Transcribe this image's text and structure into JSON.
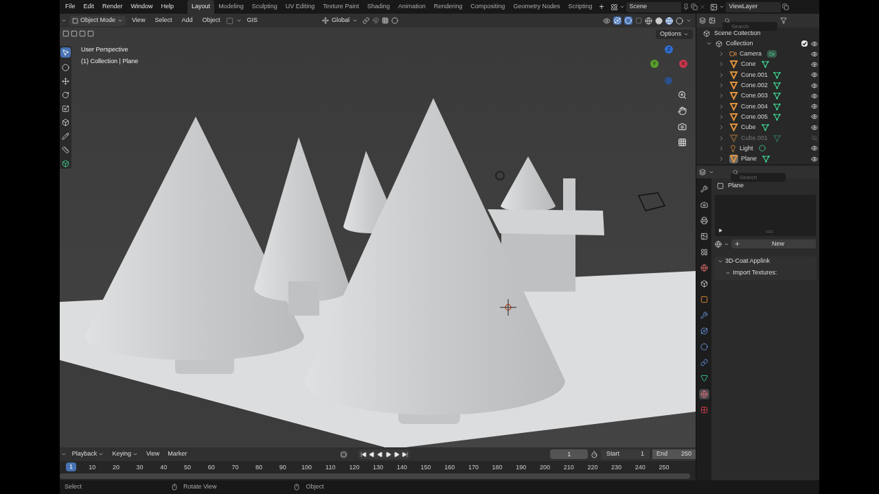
{
  "menu": [
    "File",
    "Edit",
    "Render",
    "Window",
    "Help"
  ],
  "workspaces": [
    {
      "label": "Layout",
      "selected": true
    },
    {
      "label": "Modeling",
      "selected": false
    },
    {
      "label": "Sculpting",
      "selected": false
    },
    {
      "label": "UV Editing",
      "selected": false
    },
    {
      "label": "Texture Paint",
      "selected": false
    },
    {
      "label": "Shading",
      "selected": false
    },
    {
      "label": "Animation",
      "selected": false
    },
    {
      "label": "Rendering",
      "selected": false
    },
    {
      "label": "Compositing",
      "selected": false
    },
    {
      "label": "Geometry Nodes",
      "selected": false
    },
    {
      "label": "Scripting",
      "selected": false
    }
  ],
  "add_workspace": "+",
  "scene": "Scene",
  "view_layer": "ViewLayer",
  "viewport": {
    "mode": "Object Mode",
    "menus": [
      "View",
      "Select",
      "Add",
      "Object"
    ],
    "addon_menu": "GIS",
    "orientation": "Global",
    "options": "Options",
    "overlay_lines": [
      "User Perspective",
      "(1) Collection | Plane"
    ],
    "gizmo": [
      "Z",
      "Y",
      "X"
    ]
  },
  "outliner": {
    "search_placeholder": "Search",
    "root": "Scene Collection",
    "collection": {
      "name": "Collection",
      "expanded": true,
      "checked": true,
      "children": [
        {
          "name": "Camera",
          "kind": "camera",
          "visible": true,
          "active": false
        },
        {
          "name": "Cone",
          "kind": "mesh",
          "visible": true,
          "active": false
        },
        {
          "name": "Cone.001",
          "kind": "mesh",
          "visible": true,
          "active": false
        },
        {
          "name": "Cone.002",
          "kind": "mesh",
          "visible": true,
          "active": false
        },
        {
          "name": "Cone.003",
          "kind": "mesh",
          "visible": true,
          "active": false
        },
        {
          "name": "Cone.004",
          "kind": "mesh",
          "visible": true,
          "active": false
        },
        {
          "name": "Cone.005",
          "kind": "mesh",
          "visible": true,
          "active": false
        },
        {
          "name": "Cube",
          "kind": "mesh",
          "visible": true,
          "active": false
        },
        {
          "name": "Cube.001",
          "kind": "mesh",
          "visible": false,
          "active": false
        },
        {
          "name": "Light",
          "kind": "light",
          "visible": true,
          "active": false
        },
        {
          "name": "Plane",
          "kind": "mesh",
          "visible": true,
          "active": true
        }
      ]
    }
  },
  "properties": {
    "search_placeholder": "Search",
    "tabs": [
      {
        "kind": "tool",
        "selected": false
      },
      {
        "kind": "render",
        "selected": false
      },
      {
        "kind": "output",
        "selected": false
      },
      {
        "kind": "view",
        "selected": false
      },
      {
        "kind": "scene",
        "selected": false
      },
      {
        "kind": "world",
        "selected": false
      },
      {
        "kind": "collection",
        "selected": false
      },
      {
        "kind": "object",
        "selected": false
      },
      {
        "kind": "modifier",
        "selected": false
      },
      {
        "kind": "particles",
        "selected": false
      },
      {
        "kind": "physics",
        "selected": false
      },
      {
        "kind": "constraints",
        "selected": false
      },
      {
        "kind": "data",
        "selected": false
      },
      {
        "kind": "material",
        "selected": true
      },
      {
        "kind": "texture",
        "selected": false
      }
    ],
    "object": "Plane",
    "new_button": "New",
    "panels": [
      {
        "title": "3D-Coat Applink",
        "expanded": true,
        "children": [
          {
            "title": "Import Textures:",
            "expanded": true
          }
        ]
      }
    ]
  },
  "timeline": {
    "menus": [
      "Playback",
      "Keying",
      "View",
      "Marker"
    ],
    "current_frame": "1",
    "start_label": "Start",
    "start": "1",
    "end_label": "End",
    "end": "250",
    "playhead": "1",
    "ticks": [
      "10",
      "20",
      "30",
      "40",
      "50",
      "60",
      "70",
      "80",
      "90",
      "100",
      "110",
      "120",
      "130",
      "140",
      "150",
      "160",
      "170",
      "180",
      "190",
      "200",
      "210",
      "220",
      "230",
      "240",
      "250"
    ]
  },
  "status_bar": [
    "Select",
    "Rotate View",
    "Object"
  ]
}
